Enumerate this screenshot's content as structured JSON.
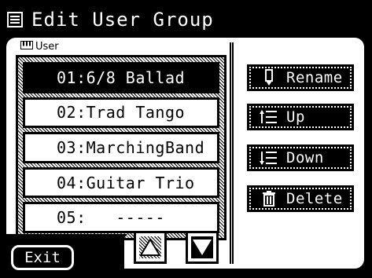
{
  "window": {
    "title": "Edit User Group"
  },
  "group": {
    "label": "User"
  },
  "list": {
    "items": [
      {
        "label": "01:6/8 Ballad",
        "selected": true
      },
      {
        "label": "02:Trad Tango",
        "selected": false
      },
      {
        "label": "03:MarchingBand",
        "selected": false
      },
      {
        "label": "04:Guitar Trio",
        "selected": false
      },
      {
        "label": "05:   -----",
        "selected": false
      }
    ]
  },
  "buttons": {
    "rename": "Rename",
    "up": "Up",
    "down": "Down",
    "delete": "Delete",
    "exit": "Exit"
  },
  "icons": {
    "title": "songbook-icon",
    "group": "keyboard-icon",
    "rename": "pen-icon",
    "up": "move-up-icon",
    "down": "move-down-icon",
    "delete": "trash-icon",
    "scroll_up": "triangle-up-icon",
    "scroll_down": "triangle-down-icon"
  },
  "colors": {
    "background": "#000000",
    "panel": "#ffffff",
    "text": "#000000"
  }
}
